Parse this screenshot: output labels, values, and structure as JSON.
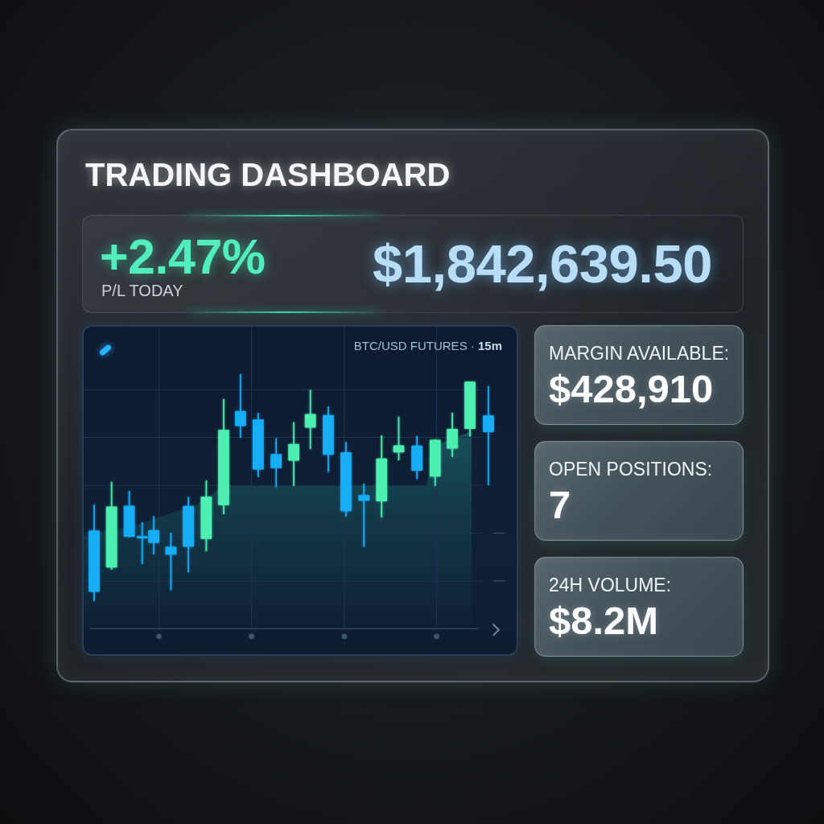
{
  "title": "TRADING DASHBOARD",
  "summary": {
    "change": "+2.47%",
    "change_label": "P/L TODAY",
    "balance": "$1,842,639.50"
  },
  "chart": {
    "title": "BTC/USD FUTURES · **15m**"
  },
  "stats": [
    {
      "label": "MARGIN AVAILABLE:",
      "value": "$428,910"
    },
    {
      "label": "OPEN POSITIONS:",
      "value": "7"
    },
    {
      "label": "24H VOLUME:",
      "value": "$8.2M"
    }
  ]
}
